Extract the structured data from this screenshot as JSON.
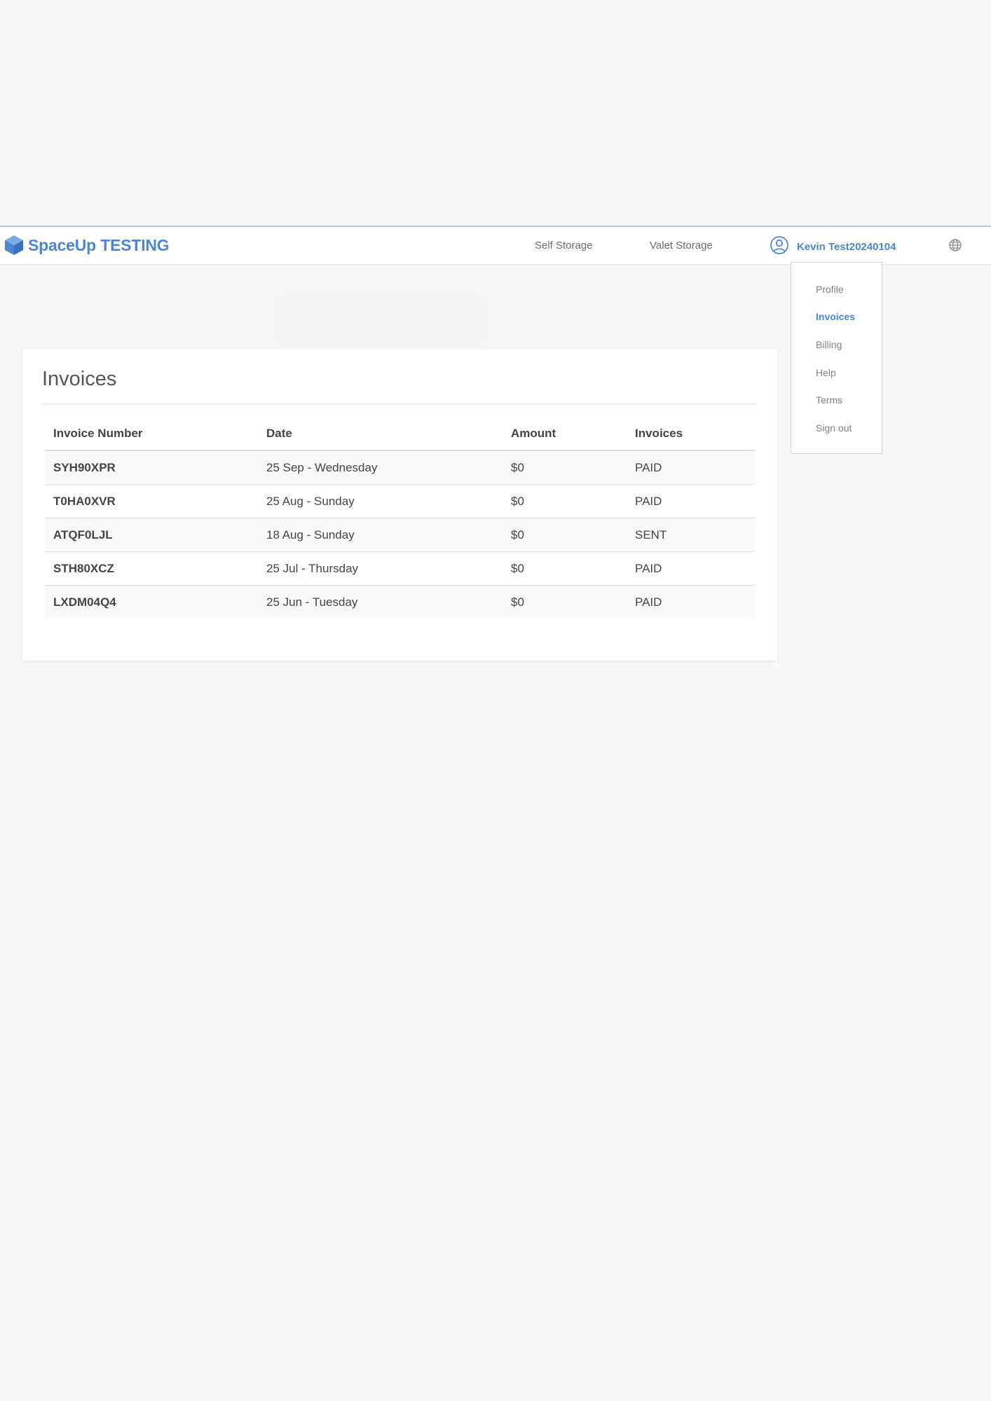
{
  "header": {
    "brand_name": "SpaceUp TESTING",
    "nav": {
      "self_storage": "Self Storage",
      "valet_storage": "Valet Storage"
    },
    "user_name": "Kevin Test20240104",
    "icons": {
      "logo": "cube-logo-icon",
      "user": "user-circle-icon",
      "language": "globe-icon"
    }
  },
  "user_menu": {
    "active_item": "Invoices",
    "items": [
      {
        "label": "Profile"
      },
      {
        "label": "Invoices"
      },
      {
        "label": "Billing"
      },
      {
        "label": "Help"
      },
      {
        "label": "Terms"
      },
      {
        "label": "Sign out"
      }
    ]
  },
  "main": {
    "title": "Invoices",
    "table": {
      "columns": [
        "Invoice Number",
        "Date",
        "Amount",
        "Invoices"
      ],
      "rows": [
        {
          "number": "SYH90XPR",
          "date": "25 Sep - Wednesday",
          "amount": "$0",
          "status": "PAID"
        },
        {
          "number": "T0HA0XVR",
          "date": "25 Aug - Sunday",
          "amount": "$0",
          "status": "PAID"
        },
        {
          "number": "ATQF0LJL",
          "date": "18 Aug - Sunday",
          "amount": "$0",
          "status": "SENT"
        },
        {
          "number": "STH80XCZ",
          "date": "25 Jul - Thursday",
          "amount": "$0",
          "status": "PAID"
        },
        {
          "number": "LXDM04Q4",
          "date": "25 Jun - Tuesday",
          "amount": "$0",
          "status": "PAID"
        }
      ]
    }
  },
  "colors": {
    "accent": "#4a86d4",
    "background": "#f7f7f7",
    "card": "#ffffff",
    "menu_text": "#7d828b"
  }
}
